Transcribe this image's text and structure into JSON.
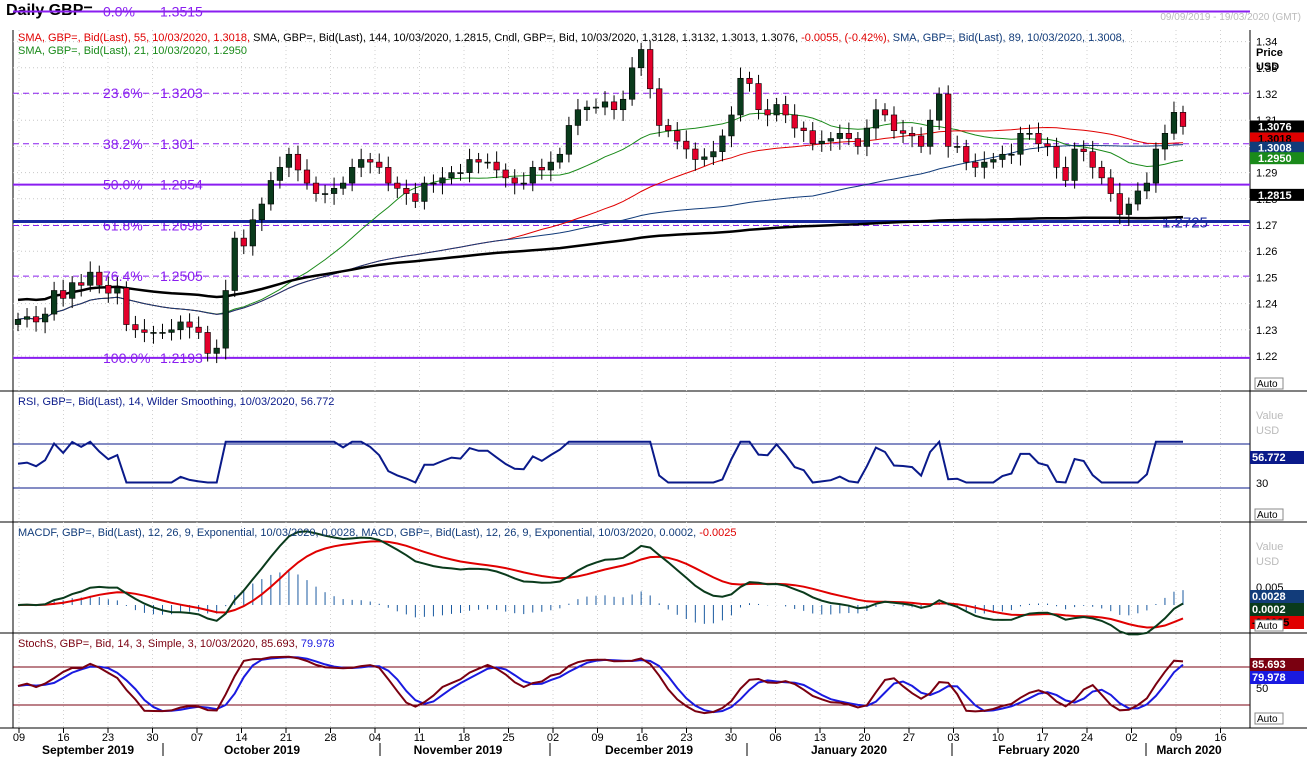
{
  "header": {
    "title": "Daily GBP=",
    "date_range": "09/09/2019 - 19/03/2020 (GMT)"
  },
  "colors": {
    "bull": "#0a3b1c",
    "bear": "#e4002b",
    "fib": "#8a1ef0",
    "sma55": "#e00000",
    "sma144": "#000000",
    "sma89": "#123c7a",
    "sma21": "#1a8a1a",
    "rsi": "#0a1a8a",
    "macd_line": "#0a3b1c",
    "macd_signal": "#e00000",
    "hist": "#1a5aa0",
    "stoch_k": "#7a0010",
    "stoch_d": "#1a1ae0"
  },
  "price_panel": {
    "legend_line1": [
      {
        "text": "SMA, GBP=, Bid(Last), 55, 10/03/2020, 1.3018, ",
        "color": "#e00000"
      },
      {
        "text": "SMA, GBP=, Bid(Last), 144, 10/03/2020, 1.2815, ",
        "color": "#000000"
      },
      {
        "text": "Cndl, GBP=, Bid, 10/03/2020, 1.3128, 1.3132, 1.3013, 1.3076, ",
        "color": "#000000"
      },
      {
        "text": "-0.0055, (-0.42%), ",
        "color": "#e00000"
      },
      {
        "text": "SMA, GBP=, Bid(Last), 89, 10/03/2020, 1.3008,",
        "color": "#123c7a"
      }
    ],
    "legend_line2": "SMA, GBP=, Bid(Last), 21, 10/03/2020, 1.2950",
    "axis_title": "Price",
    "axis_unit": "USD",
    "auto_label": "Auto",
    "ticks": [
      "1.22",
      "1.23",
      "1.24",
      "1.25",
      "1.26",
      "1.27",
      "1.28",
      "1.29",
      "1.30",
      "1.31",
      "1.32",
      "1.33",
      "1.34"
    ],
    "value_tags": [
      {
        "text": "1.3076",
        "price": 1.3076,
        "bg": "#000000",
        "fg": "#ffffff"
      },
      {
        "text": "1.3018",
        "price": 1.303,
        "bg": "#e00000",
        "fg": "#000000"
      },
      {
        "text": "1.3008",
        "price": 1.2995,
        "bg": "#123c7a",
        "fg": "#ffffff"
      },
      {
        "text": "1.2950",
        "price": 1.2955,
        "bg": "#1a8a1a",
        "fg": "#ffffff"
      },
      {
        "text": "1.2815",
        "price": 1.2815,
        "bg": "#000000",
        "fg": "#ffffff"
      }
    ],
    "fib_levels": [
      {
        "pct": "0.0%",
        "val": "1.3515",
        "price": 1.3515,
        "style": "solid"
      },
      {
        "pct": "23.6%",
        "val": "1.3203",
        "price": 1.3203,
        "style": "dash"
      },
      {
        "pct": "38.2%",
        "val": "1.301",
        "price": 1.301,
        "style": "dash"
      },
      {
        "pct": "50.0%",
        "val": "1.2854",
        "price": 1.2854,
        "style": "solid"
      },
      {
        "pct": "61.8%",
        "val": "1.2698",
        "price": 1.2698,
        "style": "dash"
      },
      {
        "pct": "76.4%",
        "val": "1.2505",
        "price": 1.2505,
        "style": "dash"
      },
      {
        "pct": "100.0%",
        "val": "1.2193",
        "price": 1.2193,
        "style": "solid"
      }
    ],
    "support_label": "1.2725",
    "support_price": 1.2725
  },
  "rsi_panel": {
    "legend": "RSI, GBP=, Bid(Last), 14, Wilder Smoothing, 10/03/2020, 56.772",
    "axis_title": "Value",
    "axis_unit": "USD",
    "tick": "30",
    "tag": "56.772",
    "auto_label": "Auto"
  },
  "macd_panel": {
    "legend_a": "MACDF, GBP=, Bid(Last), 12, 26, 9, Exponential, 10/03/2020, 0.0028, MACD, GBP=, Bid(Last), 12, 26, 9, Exponential, 10/03/2020, 0.0002,",
    "legend_b": " -0.0025",
    "axis_title": "Value",
    "axis_unit": "USD",
    "tick": "0.005",
    "tags": [
      {
        "text": "0.0028",
        "bg": "#123c7a",
        "fg": "#ffffff"
      },
      {
        "text": "0.0002",
        "bg": "#0a3b1c",
        "fg": "#ffffff"
      },
      {
        "text": "-0.0025",
        "bg": "#e00000",
        "fg": "#000000"
      }
    ],
    "auto_label": "Auto"
  },
  "stoch_panel": {
    "legend_a": "StochS, GBP=, Bid, 14, 3, Simple, 3, 10/03/2020, 85.693,",
    "legend_b": " 79.978",
    "tick": "50",
    "tags": [
      {
        "text": "85.693",
        "bg": "#7a0010",
        "fg": "#ffffff"
      },
      {
        "text": "79.978",
        "bg": "#1a1ae0",
        "fg": "#ffffff"
      }
    ],
    "auto_label": "Auto"
  },
  "x_axis": {
    "days": [
      "09",
      "16",
      "23",
      "30",
      "07",
      "14",
      "21",
      "28",
      "04",
      "11",
      "18",
      "25",
      "02",
      "09",
      "16",
      "23",
      "30",
      "06",
      "13",
      "20",
      "27",
      "03",
      "10",
      "17",
      "24",
      "02",
      "09",
      "16"
    ],
    "months": [
      "September 2019",
      "October 2019",
      "November 2019",
      "December 2019",
      "January 2020",
      "February 2020",
      "March 2020"
    ]
  },
  "chart_data": [
    {
      "type": "candlestick",
      "title": "Daily GBP=",
      "ylabel": "Price USD",
      "ylim": [
        1.215,
        1.355
      ],
      "x": [
        "2019-09-09",
        "2019-09-10",
        "2019-09-11",
        "2019-09-12",
        "2019-09-13",
        "2019-09-16",
        "2019-09-17",
        "2019-09-18",
        "2019-09-19",
        "2019-09-20",
        "2019-09-23",
        "2019-09-24",
        "2019-09-25",
        "2019-09-26",
        "2019-09-27",
        "2019-09-30",
        "2019-10-01",
        "2019-10-02",
        "2019-10-03",
        "2019-10-04",
        "2019-10-07",
        "2019-10-08",
        "2019-10-09",
        "2019-10-10",
        "2019-10-11",
        "2019-10-14",
        "2019-10-15",
        "2019-10-16",
        "2019-10-17",
        "2019-10-18",
        "2019-10-21",
        "2019-10-22",
        "2019-10-23",
        "2019-10-24",
        "2019-10-25",
        "2019-10-28",
        "2019-10-29",
        "2019-10-30",
        "2019-10-31",
        "2019-11-01",
        "2019-11-04",
        "2019-11-05",
        "2019-11-06",
        "2019-11-07",
        "2019-11-08",
        "2019-11-11",
        "2019-11-12",
        "2019-11-13",
        "2019-11-14",
        "2019-11-15",
        "2019-11-18",
        "2019-11-19",
        "2019-11-20",
        "2019-11-21",
        "2019-11-22",
        "2019-11-25",
        "2019-11-26",
        "2019-11-27",
        "2019-11-28",
        "2019-11-29",
        "2019-12-02",
        "2019-12-03",
        "2019-12-04",
        "2019-12-05",
        "2019-12-06",
        "2019-12-09",
        "2019-12-10",
        "2019-12-11",
        "2019-12-12",
        "2019-12-13",
        "2019-12-16",
        "2019-12-17",
        "2019-12-18",
        "2019-12-19",
        "2019-12-20",
        "2019-12-23",
        "2019-12-24",
        "2019-12-26",
        "2019-12-27",
        "2019-12-30",
        "2019-12-31",
        "2020-01-02",
        "2020-01-03",
        "2020-01-06",
        "2020-01-07",
        "2020-01-08",
        "2020-01-09",
        "2020-01-10",
        "2020-01-13",
        "2020-01-14",
        "2020-01-15",
        "2020-01-16",
        "2020-01-17",
        "2020-01-20",
        "2020-01-21",
        "2020-01-22",
        "2020-01-23",
        "2020-01-24",
        "2020-01-27",
        "2020-01-28",
        "2020-01-29",
        "2020-01-30",
        "2020-01-31",
        "2020-02-03",
        "2020-02-04",
        "2020-02-05",
        "2020-02-06",
        "2020-02-07",
        "2020-02-10",
        "2020-02-11",
        "2020-02-12",
        "2020-02-13",
        "2020-02-14",
        "2020-02-17",
        "2020-02-18",
        "2020-02-19",
        "2020-02-20",
        "2020-02-21",
        "2020-02-24",
        "2020-02-25",
        "2020-02-26",
        "2020-02-27",
        "2020-02-28",
        "2020-03-02",
        "2020-03-03",
        "2020-03-04",
        "2020-03-05",
        "2020-03-06",
        "2020-03-09",
        "2020-03-10"
      ],
      "close": [
        1.234,
        1.235,
        1.233,
        1.236,
        1.245,
        1.242,
        1.248,
        1.247,
        1.252,
        1.247,
        1.244,
        1.246,
        1.232,
        1.23,
        1.229,
        1.229,
        1.229,
        1.23,
        1.233,
        1.231,
        1.229,
        1.221,
        1.223,
        1.245,
        1.265,
        1.262,
        1.272,
        1.278,
        1.287,
        1.292,
        1.297,
        1.291,
        1.286,
        1.282,
        1.282,
        1.284,
        1.286,
        1.292,
        1.295,
        1.294,
        1.292,
        1.286,
        1.284,
        1.282,
        1.279,
        1.286,
        1.286,
        1.288,
        1.29,
        1.29,
        1.295,
        1.294,
        1.294,
        1.291,
        1.288,
        1.286,
        1.286,
        1.292,
        1.291,
        1.294,
        1.297,
        1.308,
        1.314,
        1.315,
        1.315,
        1.317,
        1.314,
        1.318,
        1.33,
        1.337,
        1.322,
        1.308,
        1.306,
        1.302,
        1.299,
        1.295,
        1.296,
        1.298,
        1.304,
        1.312,
        1.326,
        1.324,
        1.314,
        1.312,
        1.316,
        1.312,
        1.307,
        1.306,
        1.301,
        1.302,
        1.303,
        1.305,
        1.303,
        1.3,
        1.307,
        1.314,
        1.312,
        1.306,
        1.305,
        1.304,
        1.3,
        1.31,
        1.32,
        1.3,
        1.3,
        1.294,
        1.292,
        1.294,
        1.295,
        1.297,
        1.297,
        1.305,
        1.305,
        1.301,
        1.3,
        1.292,
        1.287,
        1.299,
        1.298,
        1.292,
        1.288,
        1.282,
        1.274,
        1.278,
        1.283,
        1.286,
        1.299,
        1.305,
        1.313,
        1.3076
      ],
      "sma21_tail": 1.295,
      "sma55_tail": 1.3018,
      "sma89_tail": 1.3008,
      "sma144_tail": 1.2815,
      "fibonacci_retracement": {
        "0.0%": 1.3515,
        "23.6%": 1.3203,
        "38.2%": 1.301,
        "50.0%": 1.2854,
        "61.8%": 1.2698,
        "76.4%": 1.2505,
        "100.0%": 1.2193
      },
      "support": 1.2725
    },
    {
      "type": "line",
      "title": "RSI, 14, Wilder Smoothing",
      "last": 56.772,
      "levels": [
        30,
        70
      ]
    },
    {
      "type": "line",
      "title": "MACD 12, 26, 9",
      "macd": 0.0002,
      "signal": -0.0025,
      "histogram": 0.0028
    },
    {
      "type": "line",
      "title": "Slow Stochastic 14, 3, 3",
      "k": 85.693,
      "d": 79.978,
      "levels": [
        20,
        80
      ]
    }
  ]
}
